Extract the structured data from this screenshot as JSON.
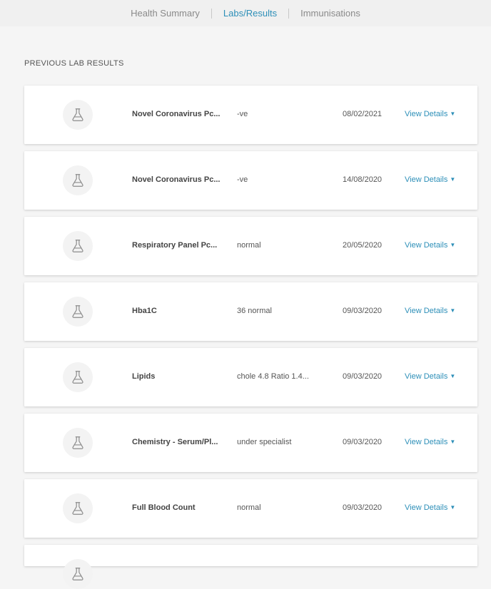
{
  "tabs": [
    {
      "label": "Health Summary",
      "active": false
    },
    {
      "label": "Labs/Results",
      "active": true
    },
    {
      "label": "Immunisations",
      "active": false
    }
  ],
  "section_title": "PREVIOUS LAB RESULTS",
  "details_label": "View Details",
  "details_icon": "chevron-down-icon",
  "row_icon": "flask-icon",
  "colors": {
    "accent": "#2d8fb8",
    "text": "#444444",
    "muted": "#8a8a8a"
  },
  "results": [
    {
      "name": "Novel Coronavirus Pc...",
      "result": "-ve",
      "date": "08/02/2021"
    },
    {
      "name": "Novel Coronavirus Pc...",
      "result": "-ve",
      "date": "14/08/2020"
    },
    {
      "name": "Respiratory Panel Pc...",
      "result": "normal",
      "date": "20/05/2020"
    },
    {
      "name": "Hba1C",
      "result": "36 normal",
      "date": "09/03/2020"
    },
    {
      "name": "Lipids",
      "result": "chole 4.8 Ratio 1.4...",
      "date": "09/03/2020"
    },
    {
      "name": "Chemistry - Serum/Pl...",
      "result": "under specialist",
      "date": "09/03/2020"
    },
    {
      "name": "Full Blood Count",
      "result": "normal",
      "date": "09/03/2020"
    }
  ]
}
